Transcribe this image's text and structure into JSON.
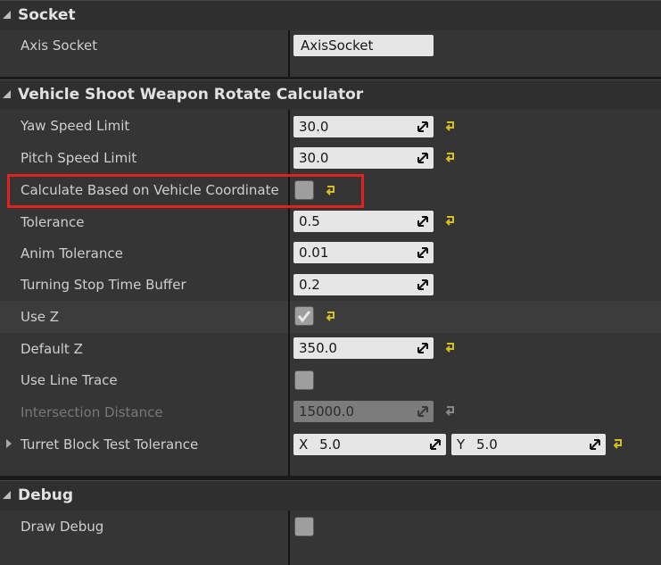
{
  "categories": {
    "socket": "Socket",
    "calculator": "Vehicle Shoot Weapon Rotate Calculator",
    "debug": "Debug"
  },
  "properties": {
    "axis_socket": {
      "label": "Axis Socket",
      "value": "AxisSocket"
    },
    "yaw_speed_limit": {
      "label": "Yaw Speed Limit",
      "value": "30.0"
    },
    "pitch_speed_limit": {
      "label": "Pitch Speed Limit",
      "value": "30.0"
    },
    "calculate_based_on_vehicle_coordinate": {
      "label": "Calculate Based on Vehicle Coordinate",
      "checked": false
    },
    "tolerance": {
      "label": "Tolerance",
      "value": "0.5"
    },
    "anim_tolerance": {
      "label": "Anim Tolerance",
      "value": "0.01"
    },
    "turning_stop_time_buffer": {
      "label": "Turning Stop Time Buffer",
      "value": "0.2"
    },
    "use_z": {
      "label": "Use Z",
      "checked": true
    },
    "default_z": {
      "label": "Default Z",
      "value": "350.0"
    },
    "use_line_trace": {
      "label": "Use Line Trace",
      "checked": false
    },
    "intersection_distance": {
      "label": "Intersection Distance",
      "value": "15000.0",
      "disabled": true
    },
    "turret_block_test_tolerance": {
      "label": "Turret Block Test Tolerance",
      "x_label": "X",
      "x_value": "5.0",
      "y_label": "Y",
      "y_value": "5.0"
    },
    "draw_debug": {
      "label": "Draw Debug",
      "checked": false
    }
  },
  "colors": {
    "highlight_box": "#e32020",
    "reset_arrow": "#d6c21a"
  },
  "icons": {
    "collapse": "collapse-triangle-icon",
    "drag": "drag-handle-icon",
    "reset": "reset-to-default-icon",
    "expand": "expand-arrow-icon",
    "check": "checkmark-icon"
  }
}
